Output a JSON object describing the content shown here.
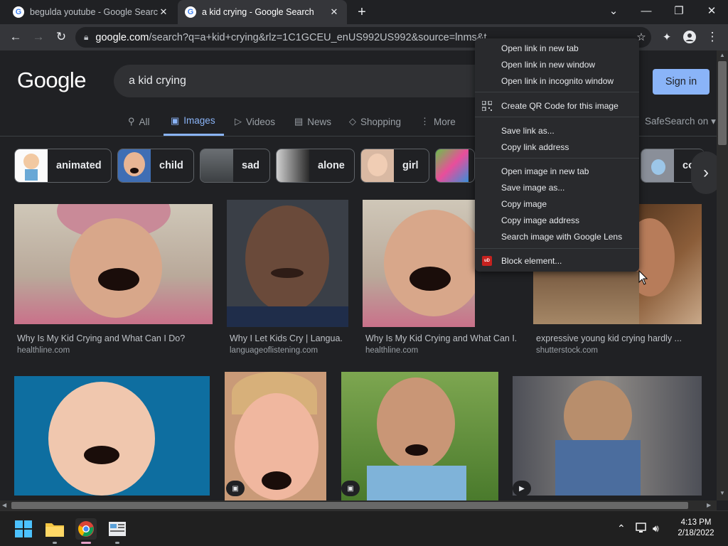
{
  "browser": {
    "tabs": [
      {
        "title": "begulda youtube - Google Search",
        "active": false
      },
      {
        "title": "a kid crying - Google Search",
        "active": true
      }
    ],
    "new_tab_label": "+",
    "url_host": "google.com",
    "url_rest": "/search?q=a+kid+crying&rlz=1C1GCEU_enUS992US992&source=lnms&t",
    "window_controls": {
      "dropdown": "⌄",
      "minimize": "—",
      "restore": "❐",
      "close": "✕"
    }
  },
  "google": {
    "logo": "Google",
    "query": "a kid crying",
    "sign_in": "Sign in",
    "safesearch": "SafeSearch on",
    "tabs": [
      {
        "label": "All",
        "icon": "search-icon"
      },
      {
        "label": "Images",
        "icon": "image-icon",
        "active": true
      },
      {
        "label": "Videos",
        "icon": "play-icon"
      },
      {
        "label": "News",
        "icon": "news-icon"
      },
      {
        "label": "Shopping",
        "icon": "tag-icon"
      },
      {
        "label": "More",
        "icon": "more-vert-icon"
      }
    ],
    "chips": [
      {
        "label": "animated"
      },
      {
        "label": "child"
      },
      {
        "label": "sad"
      },
      {
        "label": "alone"
      },
      {
        "label": "girl"
      },
      {
        "label": ""
      },
      {
        "label": "co"
      }
    ],
    "results": [
      {
        "caption": "Why Is My Kid Crying and What Can I Do?",
        "source": "healthline.com"
      },
      {
        "caption": "Why I Let Kids Cry | Langua...",
        "source": "languageoflistening.com"
      },
      {
        "caption": "Why Is My Kid Crying and What Can I...",
        "source": "healthline.com"
      },
      {
        "caption": "expressive young kid crying hardly ...",
        "source": "shutterstock.com"
      }
    ]
  },
  "context_menu": {
    "items": [
      "Open link in new tab",
      "Open link in new window",
      "Open link in incognito window",
      "Create QR Code for this image",
      "Save link as...",
      "Copy link address",
      "Open image in new tab",
      "Save image as...",
      "Copy image",
      "Copy image address",
      "Search image with Google Lens",
      "Block element..."
    ]
  },
  "taskbar": {
    "time": "4:13 PM",
    "date": "2/18/2022"
  },
  "colors": {
    "accent": "#8ab4f8",
    "background": "#202124",
    "menu": "#292a2d"
  }
}
